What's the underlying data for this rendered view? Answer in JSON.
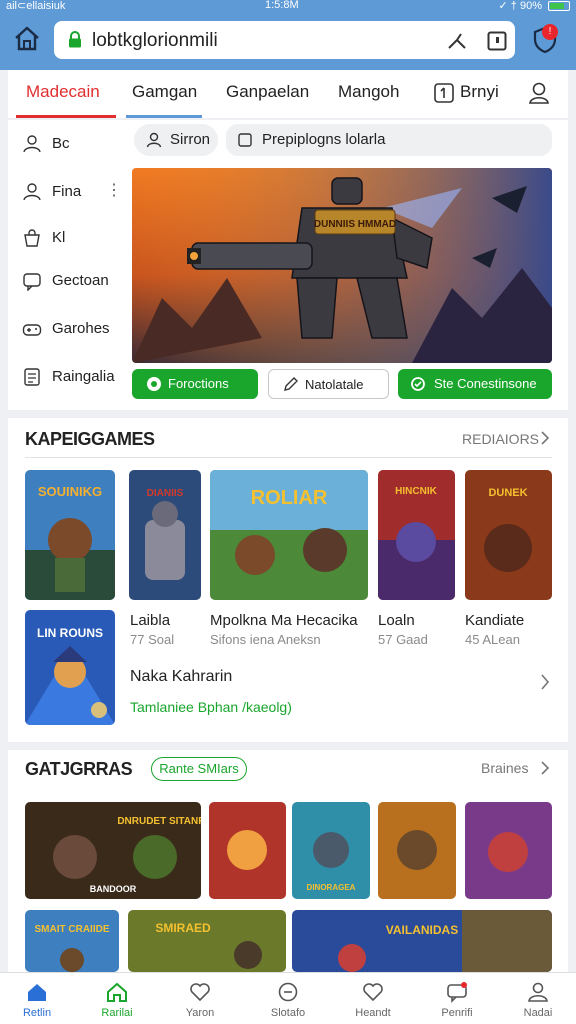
{
  "status_bar": {
    "left": "ail⊂ellaisiuk",
    "center": "1:5:8M",
    "right": "✓ † 90%"
  },
  "browser": {
    "url": "lobtkglorionmili"
  },
  "nav_tabs": [
    {
      "label": "Madecain",
      "active": true
    },
    {
      "label": "Gamgan"
    },
    {
      "label": "Ganpaelan"
    },
    {
      "label": "Mangoh"
    },
    {
      "label": "Brnyi"
    }
  ],
  "notification_count": "!",
  "sidebar": [
    {
      "label": "Bc",
      "icon": "person-icon"
    },
    {
      "label": "Fina",
      "icon": "person-icon"
    },
    {
      "label": "Kl",
      "icon": "bag-icon"
    },
    {
      "label": "Gectoan",
      "icon": "chat-icon"
    },
    {
      "label": "Garohes",
      "icon": "gamepad-icon"
    },
    {
      "label": "Raingalia",
      "icon": "document-icon"
    }
  ],
  "search_chips": {
    "first": "Sirron",
    "second": "Prepiplogns lolarla"
  },
  "hero": {
    "badge_text": "DUNNIIS HMMAD"
  },
  "action_buttons": [
    {
      "label": "Foroctions",
      "style": "green"
    },
    {
      "label": "Natolatale",
      "style": "white"
    },
    {
      "label": "Ste Conestinsone",
      "style": "green"
    }
  ],
  "section1": {
    "title": "KAPEIGGAMES",
    "more": "REDIAIORS",
    "cards": [
      {
        "art": "SOUINIKG",
        "color": "#3d7fbf"
      },
      {
        "art": "DIANIIS",
        "color": "#2c4a7a"
      },
      {
        "art": "ROLIAR",
        "color": "#4c8a3a"
      },
      {
        "art": "HINCNIK",
        "color": "#a02c2c"
      },
      {
        "art": "DUNEK",
        "color": "#8a3a1a"
      }
    ],
    "info": [
      {
        "name": "Laibla",
        "meta": "77 Soal"
      },
      {
        "name": "Mpolkna Ma Hecacika",
        "meta": "Sifons iena Aneksn"
      },
      {
        "name": "Loaln",
        "meta": "57 Gaad"
      },
      {
        "name": "Kandiate",
        "meta": "45 ALean"
      }
    ],
    "featured": {
      "art": "LIN ROUNS",
      "name": "Naka Kahrarin",
      "link": "Tamlaniee Bphan /kaeolg)"
    }
  },
  "section2": {
    "title": "GATJGRRAS",
    "pill": "Rante SMIars",
    "more": "Braines",
    "row1": [
      {
        "art": "DNRUDET SITANRN",
        "caption": "BANDOOR",
        "color": "#3a2a1a"
      },
      {
        "art": "",
        "color": "#b0342a"
      },
      {
        "art": "DINORAGEA",
        "color": "#2f8fa8"
      },
      {
        "art": "",
        "color": "#b8701f"
      },
      {
        "art": "",
        "color": "#7a3a8a"
      }
    ],
    "row2": [
      {
        "art": "SMAIT CRAIIDE",
        "color": "#3d7fbf"
      },
      {
        "art": "SMIRAED",
        "color": "#6a7a2a"
      },
      {
        "art": "VAILANIDAS",
        "color": "#2a4a9a"
      }
    ]
  },
  "bottom_nav": [
    {
      "label": "Retlin",
      "icon": "home-icon",
      "state": "active"
    },
    {
      "label": "Rarilai",
      "icon": "home-icon",
      "state": "green"
    },
    {
      "label": "Yaron",
      "icon": "heart-icon"
    },
    {
      "label": "Slotafo",
      "icon": "clock-icon"
    },
    {
      "label": "Heandt",
      "icon": "heart-icon"
    },
    {
      "label": "Penrifi",
      "icon": "chat-icon"
    },
    {
      "label": "Nadai",
      "icon": "person-icon"
    }
  ]
}
